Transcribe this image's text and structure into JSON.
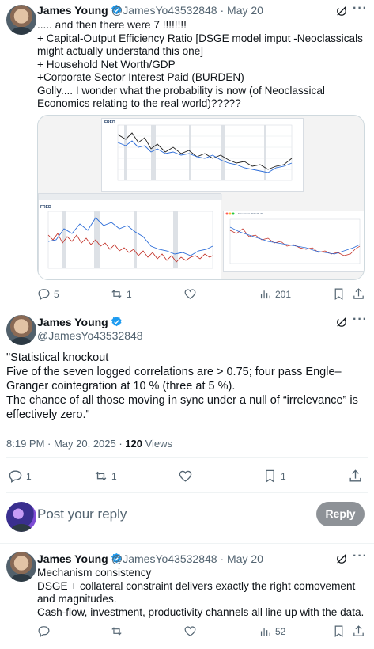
{
  "tweet1": {
    "author": "James Young",
    "handle": "@JamesYo43532848",
    "date": "May 20",
    "text": "..... and then there were 7 !!!!!!!!\n+  Capital-Output Efficiency Ratio [DSGE model imput -Neoclassicals might actually understand this one]\n+ Household Net Worth/GDP\n+Corporate Sector Interest Paid (BURDEN)\nGolly.... I wonder what the probability is now  (of Neoclassical Economics relating to the real world)?????",
    "replies": "5",
    "retweets": "1",
    "views": "201"
  },
  "tweet2": {
    "author": "James Young",
    "handle": "@JamesYo43532848",
    "text": "\"Statistical knockout\nFive of the seven logged correlations are > 0.75; four pass Engle–Granger cointegration at 10 % (three at 5 %).\nThe chance of all those moving in sync under a null of “irrelevance” is effectively zero.\"",
    "time": "8:19 PM · May 20, 2025 · ",
    "view_count": "120",
    "views_label": " Views",
    "replies": "1",
    "retweets": "1",
    "bookmarks": "1"
  },
  "reply_box": {
    "placeholder": "Post your reply",
    "button": "Reply"
  },
  "tweet3": {
    "author": "James Young",
    "handle": "@JamesYo43532848",
    "date": "May 20",
    "text": "Mechanism consistency\nDSGE + collateral constraint delivers exactly the right comovement and magnitudes.\nCash-flow, investment, productivity channels all line up with the data.",
    "views": "52"
  },
  "media": {
    "logo": "FRED",
    "window_title": "Screenshot 2025-05-20..."
  },
  "colors": {
    "accent": "#1d9bf0",
    "series_dark": "#222222",
    "series_blue": "#2b6cd8",
    "series_red": "#c0281e"
  }
}
